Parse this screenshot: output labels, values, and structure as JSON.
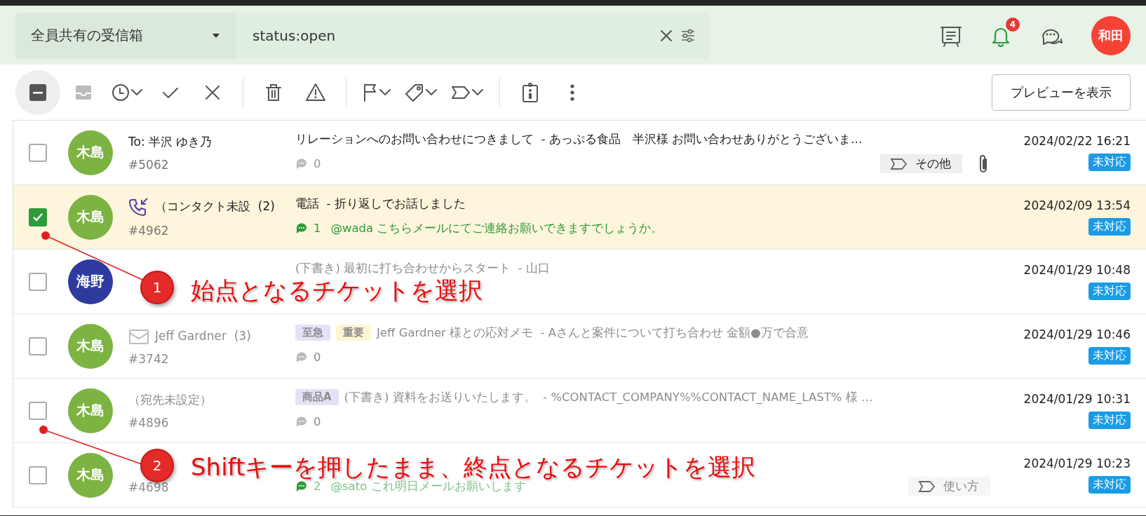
{
  "header": {
    "inbox_select": {
      "label": "全員共有の受信箱"
    },
    "search": {
      "value": "status:open"
    },
    "notification_count": "4",
    "user_avatar": "和田"
  },
  "toolbar": {
    "preview_button": "プレビューを表示"
  },
  "tickets": [
    {
      "selected": false,
      "checked": false,
      "dimmed": false,
      "assignee": {
        "name": "木島",
        "color": "#7cb342"
      },
      "name": "To: 半沢 ゆき乃",
      "id": "#5062",
      "subject": "リレーションへのお問い合わせにつきまして  - あっぷる食品　半沢様 お問い合わせありがとうございま…",
      "comment_count": "0",
      "label_tag": "その他",
      "attachment": true,
      "date": "2024/02/22 16:21",
      "status": "未対応"
    },
    {
      "selected": true,
      "checked": true,
      "dimmed": false,
      "assignee": {
        "name": "木島",
        "color": "#7cb342"
      },
      "kind": "phone",
      "name": "（コンタクト未設  (2)",
      "id": "#4962",
      "subject": "電話  - 折り返しでお話しました",
      "comment_count": "1",
      "comment": "@wada こちらメールにてご連絡お願いできますでしょうか。",
      "attachment": false,
      "date": "2024/02/09 13:54",
      "status": "未対応"
    },
    {
      "selected": false,
      "checked": false,
      "dimmed": true,
      "assignee": {
        "name": "海野",
        "color": "#2e3a9e"
      },
      "subject": "(下書き) 最初に打ち合わせからスタート  - 山口",
      "attachment": false,
      "date": "2024/01/29 10:48",
      "status": "未対応"
    },
    {
      "selected": false,
      "checked": false,
      "dimmed": true,
      "assignee": {
        "name": "木島",
        "color": "#7cb342"
      },
      "kind": "mail",
      "name": "Jeff Gardner  (3)",
      "id": "#3742",
      "tags": [
        {
          "label": "至急",
          "color": "#e3e2f6"
        },
        {
          "label": "重要",
          "color": "#fcf6d2"
        }
      ],
      "subject": "Jeff Gardner 様との応対メモ  - Aさんと案件について打ち合わせ 金額●万で合意",
      "comment_count": "0",
      "attachment": false,
      "date": "2024/01/29 10:46",
      "status": "未対応"
    },
    {
      "selected": false,
      "checked": false,
      "dimmed": true,
      "assignee": {
        "name": "木島",
        "color": "#7cb342"
      },
      "name": "（宛先未設定）",
      "id": "#4896",
      "tags": [
        {
          "label": "商品A",
          "color": "#e3e2f6"
        }
      ],
      "subject": "(下書き) 資料をお送りいたします。  - %CONTACT_COMPANY%%CONTACT_NAME_LAST% 様 …",
      "comment_count": "0",
      "attachment": false,
      "date": "2024/01/29 10:31",
      "status": "未対応"
    },
    {
      "selected": false,
      "checked": false,
      "dimmed": true,
      "assignee": {
        "name": "木島",
        "color": "#7cb342"
      },
      "id": "#4698",
      "comment_count": "2",
      "comment": "@sato これ明日メールお願いします",
      "label_tag": "使い方",
      "attachment": false,
      "date": "2024/01/29 10:23",
      "status": "未対応"
    }
  ],
  "annotations": [
    {
      "number": "1",
      "text": "始点となるチケットを選択"
    },
    {
      "number": "2",
      "text": "Shiftキーを押したまま、終点となるチケットを選択"
    }
  ]
}
